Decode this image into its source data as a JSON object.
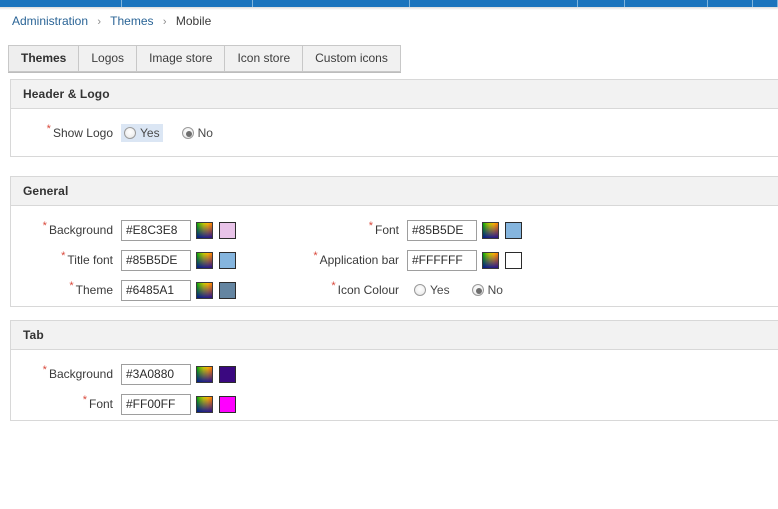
{
  "topnav": {
    "segment_count": 8,
    "color": "#1b74bd"
  },
  "breadcrumb": {
    "items": [
      {
        "label": "Administration",
        "link": true
      },
      {
        "label": "Themes",
        "link": true
      },
      {
        "label": "Mobile",
        "link": false
      }
    ],
    "separator": "›"
  },
  "tabs": [
    {
      "label": "Themes",
      "active": true
    },
    {
      "label": "Logos",
      "active": false
    },
    {
      "label": "Image store",
      "active": false
    },
    {
      "label": "Icon store",
      "active": false
    },
    {
      "label": "Custom icons",
      "active": false
    }
  ],
  "sections": {
    "header_logo": {
      "title": "Header & Logo",
      "show_logo": {
        "label": "Show Logo",
        "required": "*",
        "yes_label": "Yes",
        "no_label": "No",
        "selected": "No"
      }
    },
    "general": {
      "title": "General",
      "background": {
        "label": "Background",
        "required": "*",
        "value": "#E8C3E8",
        "swatch": "#E8C3E8",
        "picker_icon": "color-gradient-icon"
      },
      "title_font": {
        "label": "Title font",
        "required": "*",
        "value": "#85B5DE",
        "swatch": "#85B5DE",
        "picker_icon": "color-gradient-icon"
      },
      "theme": {
        "label": "Theme",
        "required": "*",
        "value": "#6485A1",
        "swatch": "#6485A1",
        "picker_icon": "color-gradient-icon"
      },
      "font": {
        "label": "Font",
        "required": "*",
        "value": "#85B5DE",
        "swatch": "#85B5DE",
        "picker_icon": "color-gradient-icon"
      },
      "application_bar": {
        "label": "Application bar",
        "required": "*",
        "value": "#FFFFFF",
        "swatch": "#FFFFFF",
        "picker_icon": "color-gradient-icon"
      },
      "icon_colour": {
        "label": "Icon Colour",
        "required": "*",
        "yes_label": "Yes",
        "no_label": "No",
        "selected": "No"
      }
    },
    "tab": {
      "title": "Tab",
      "background": {
        "label": "Background",
        "required": "*",
        "value": "#3A0880",
        "swatch": "#3A0880",
        "picker_icon": "color-gradient-icon"
      },
      "font": {
        "label": "Font",
        "required": "*",
        "value": "#FF00FF",
        "swatch": "#FF00FF",
        "picker_icon": "color-gradient-icon"
      }
    }
  }
}
